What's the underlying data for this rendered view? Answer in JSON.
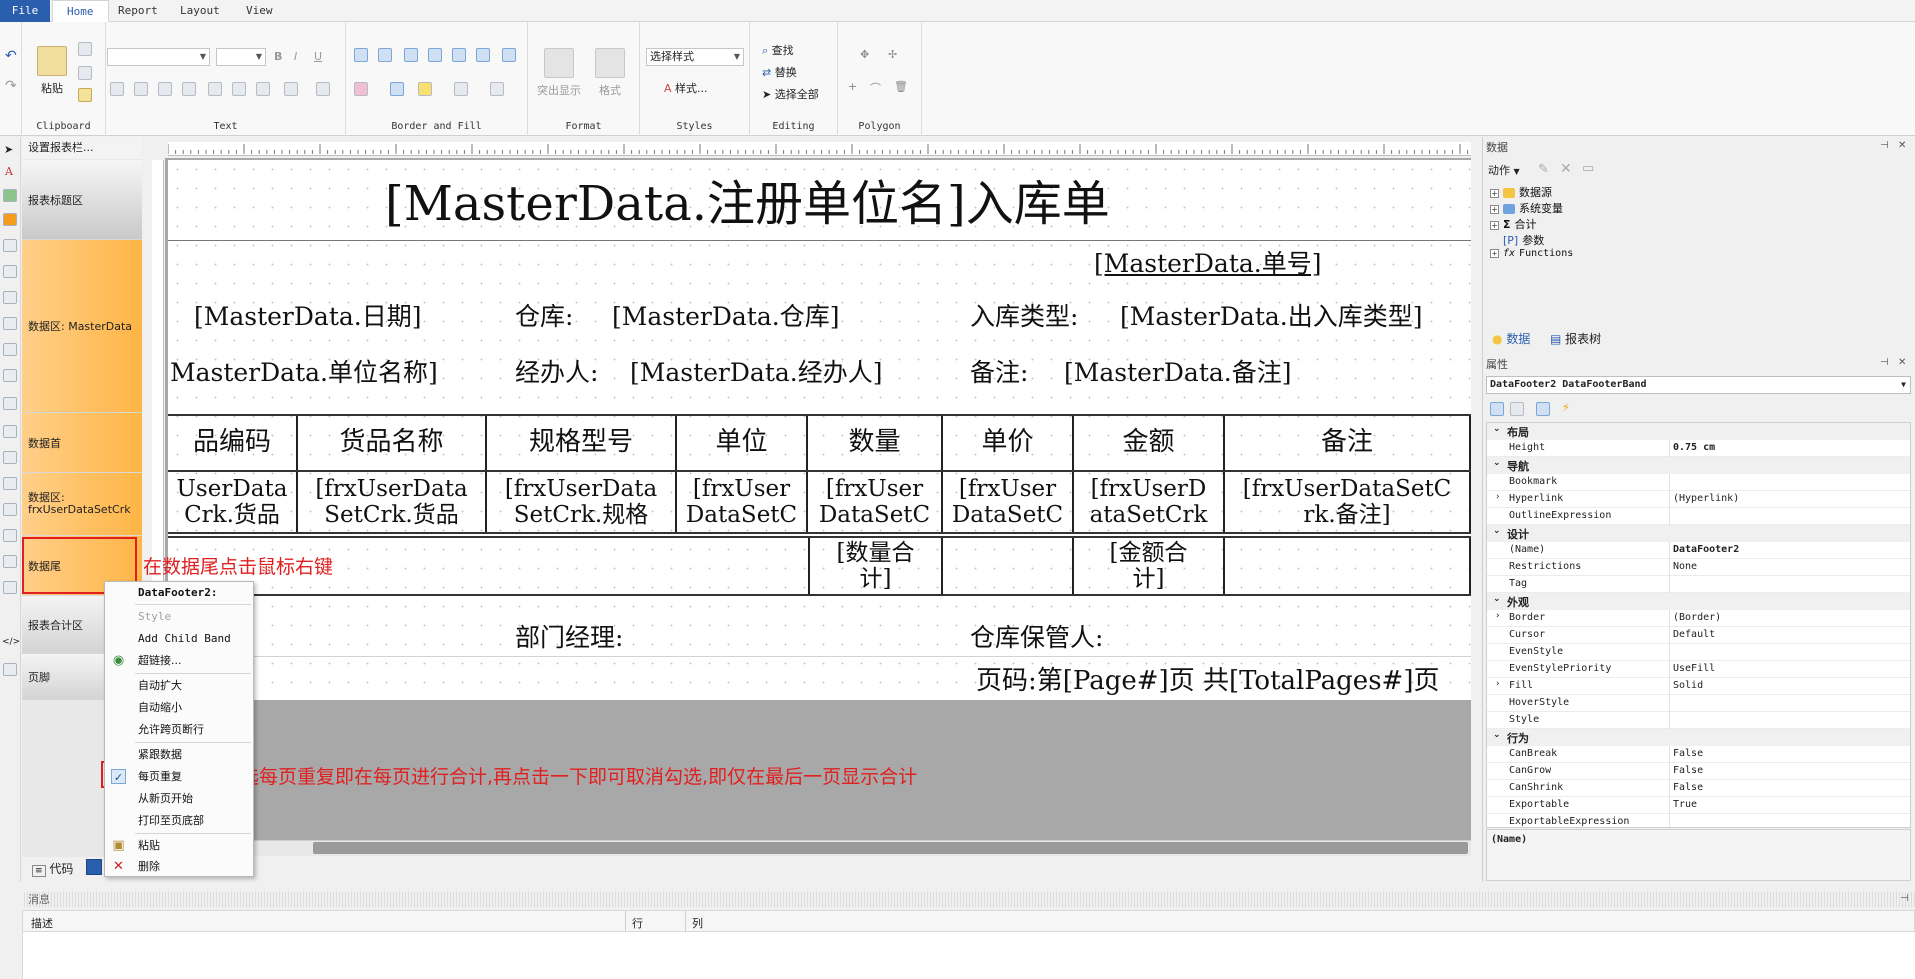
{
  "ribbon": {
    "tabs": [
      "File",
      "Home",
      "Report",
      "Layout",
      "View"
    ],
    "active_tab": "Home",
    "groups": {
      "clipboard": {
        "label": "Clipboard",
        "paste": "粘贴"
      },
      "text": {
        "label": "Text"
      },
      "border": {
        "label": "Border and Fill"
      },
      "format": {
        "label": "Format",
        "highlight": "突出显示",
        "style": "格式"
      },
      "styles": {
        "label": "Styles",
        "style_select": "选择样式",
        "styles_btn": "样式..."
      },
      "editing": {
        "label": "Editing",
        "find": "查找",
        "replace": "替换",
        "select_all": "选择全部"
      },
      "polygon": {
        "label": "Polygon"
      }
    }
  },
  "bands": {
    "header_label": "设置报表栏...",
    "items": [
      "报表标题区",
      "数据区: MasterData",
      "数据首",
      "数据区: frxUserDataSetCrk",
      "数据尾",
      "报表合计区",
      "页脚"
    ]
  },
  "report": {
    "title": "[MasterData.注册单位名]入库单",
    "order_no": "[MasterData.单号]",
    "date": "[MasterData.日期]",
    "warehouse_label": "仓库:",
    "warehouse": "[MasterData.仓库]",
    "type_label": "入库类型:",
    "type": "[MasterData.出入库类型]",
    "unit_name": "MasterData.单位名称]",
    "handler_label": "经办人:",
    "handler": "[MasterData.经办人]",
    "remark_label": "备注:",
    "remark": "[MasterData.备注]",
    "table_headers": [
      "品编码",
      "货品名称",
      "规格型号",
      "单位",
      "数量",
      "单价",
      "金额",
      "备注"
    ],
    "table_data": [
      "UserData\nCrk.货品",
      "[frxUserData\nSetCrk.货品",
      "[frxUserData\nSetCrk.规格",
      "[frxUser\nDataSetC",
      "[frxUser\nDataSetC",
      "[frxUser\nDataSetC",
      "[frxUserD\nataSetCrk",
      "[frxUserDataSetC\nrk.备注]"
    ],
    "qty_total": "[数量合\n计]",
    "amount_total": "[金额合\n计]",
    "dept_manager": "部门经理:",
    "keeper": "仓库保管人:",
    "page_footer": "页码:第[Page#]页 共[TotalPages#]页"
  },
  "annotations": {
    "right_click": "在数据尾点击鼠标右键",
    "repeat_note": "勾选每页重复即在每页进行合计,再点击一下即可取消勾选,即仅在最后一页显示合计"
  },
  "context_menu": {
    "title": "DataFooter2:",
    "items": [
      {
        "label": "Style",
        "disabled": true
      },
      {
        "label": "Add Child Band"
      },
      {
        "label": "超链接..."
      },
      {
        "label": "自动扩大"
      },
      {
        "label": "自动缩小"
      },
      {
        "label": "允许跨页断行"
      },
      {
        "label": "紧跟数据"
      },
      {
        "label": "每页重复",
        "checked": true
      },
      {
        "label": "从新页开始"
      },
      {
        "label": "打印至页底部"
      },
      {
        "label": "粘贴"
      },
      {
        "label": "删除"
      }
    ]
  },
  "data_panel": {
    "title": "数据",
    "actions": "动作",
    "tree": [
      "数据源",
      "系统变量",
      "合计",
      "参数",
      "Functions"
    ],
    "tabs": [
      "数据",
      "报表树"
    ]
  },
  "properties": {
    "title": "属性",
    "object": "DataFooter2 DataFooterBand",
    "rows": [
      {
        "cat": "布局"
      },
      {
        "name": "Height",
        "value": "0.75 cm",
        "bold": true
      },
      {
        "cat": "导航"
      },
      {
        "name": "Bookmark",
        "value": ""
      },
      {
        "name": "Hyperlink",
        "value": "(Hyperlink)",
        "exp": true
      },
      {
        "name": "OutlineExpression",
        "value": ""
      },
      {
        "cat": "设计"
      },
      {
        "name": "(Name)",
        "value": "DataFooter2",
        "bold": true
      },
      {
        "name": "Restrictions",
        "value": "None"
      },
      {
        "name": "Tag",
        "value": ""
      },
      {
        "cat": "外观"
      },
      {
        "name": "Border",
        "value": "(Border)",
        "exp": true
      },
      {
        "name": "Cursor",
        "value": "Default"
      },
      {
        "name": "EvenStyle",
        "value": ""
      },
      {
        "name": "EvenStylePriority",
        "value": "UseFill"
      },
      {
        "name": "Fill",
        "value": "Solid",
        "exp": true
      },
      {
        "name": "HoverStyle",
        "value": ""
      },
      {
        "name": "Style",
        "value": ""
      },
      {
        "cat": "行为"
      },
      {
        "name": "CanBreak",
        "value": "False"
      },
      {
        "name": "CanGrow",
        "value": "False"
      },
      {
        "name": "CanShrink",
        "value": "False"
      },
      {
        "name": "Exportable",
        "value": "True"
      },
      {
        "name": "ExportableExpression",
        "value": ""
      }
    ],
    "description": "(Name)"
  },
  "bottom": {
    "code_tab": "代码",
    "messages_title": "消息",
    "columns": [
      "描述",
      "行",
      "列"
    ]
  },
  "colors": {
    "accent": "#2a5fad",
    "band_orange": "#ffb545",
    "annotation_red": "#e02020"
  }
}
